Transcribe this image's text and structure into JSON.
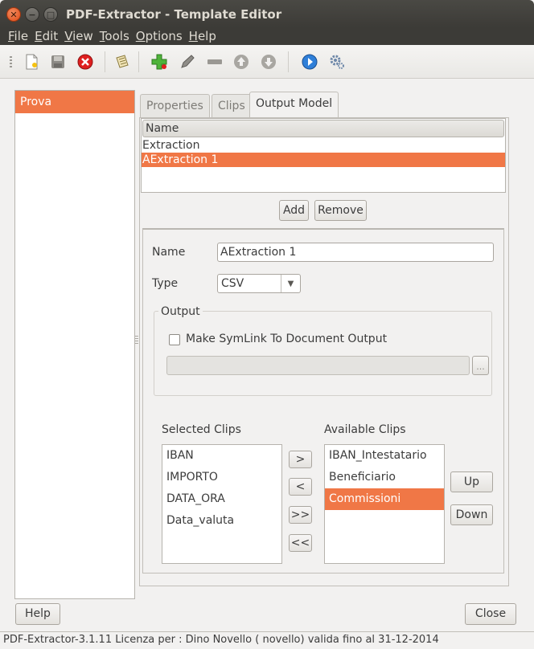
{
  "window": {
    "title": "PDF-Extractor - Template Editor"
  },
  "menu": [
    "File",
    "Edit",
    "View",
    "Tools",
    "Options",
    "Help"
  ],
  "toolbar": {
    "icons": [
      "new-document-icon",
      "save-icon",
      "close-document-icon",
      "open-template-icon",
      "add-icon",
      "edit-icon",
      "remove-icon",
      "move-up-icon",
      "move-down-icon",
      "run-icon",
      "settings-icon"
    ]
  },
  "templates": [
    "Prova"
  ],
  "tabs": [
    "Properties",
    "Clips",
    "Output Model"
  ],
  "output_table": {
    "header": "Name",
    "rows": [
      "Extraction",
      "AExtraction 1"
    ],
    "selected": "AExtraction 1"
  },
  "buttons": {
    "add": "Add",
    "remove": "Remove",
    "move_right": ">",
    "move_left": "<",
    "move_all_right": ">>",
    "move_all_left": "<<",
    "up": "Up",
    "down": "Down",
    "help": "Help",
    "close": "Close",
    "browse": "..."
  },
  "form": {
    "name_label": "Name",
    "name_value": "AExtraction 1",
    "type_label": "Type",
    "type_value": "CSV",
    "output_group": "Output",
    "symlink_label": "Make SymLink To Document Output",
    "symlink_checked": false,
    "output_path": ""
  },
  "clips": {
    "selected_label": "Selected Clips",
    "available_label": "Available Clips",
    "selected": [
      "IBAN",
      "IMPORTO",
      "DATA_ORA",
      "Data_valuta"
    ],
    "available": [
      "IBAN_Intestatario",
      "Beneficiario",
      "Commissioni"
    ],
    "available_highlighted": "Commissioni"
  },
  "colors": {
    "accent": "#f07746",
    "titlebar": "#3c3b37",
    "window_bg": "#f2f1f0"
  },
  "status": "PDF-Extractor-3.1.11  Licenza per : Dino Novello ( novello) valida fino al 31-12-2014"
}
